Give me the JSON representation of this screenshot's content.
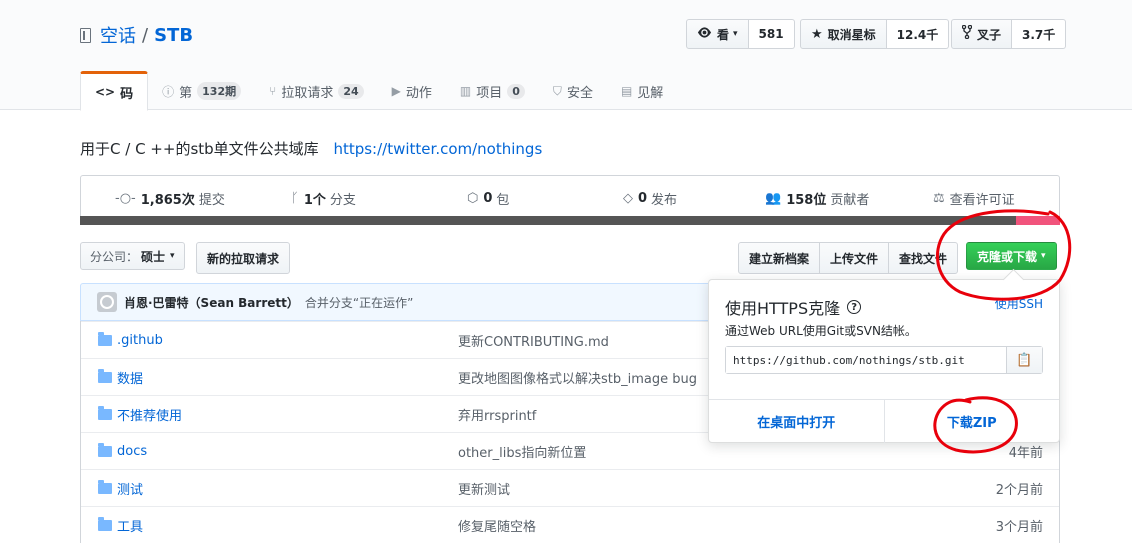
{
  "repo": {
    "owner": "空话",
    "separator": "/",
    "name": "STB"
  },
  "actions": {
    "watch_label": "看",
    "watch_count": "581",
    "star_label": "取消星标",
    "star_count": "12.4千",
    "fork_label": "叉子",
    "fork_count": "3.7千"
  },
  "tabs": [
    {
      "label": "码",
      "icon": "code-icon"
    },
    {
      "label": "第",
      "counter": "132期",
      "icon": "issue-icon"
    },
    {
      "label": "拉取请求",
      "counter": "24",
      "icon": "pull-request-icon"
    },
    {
      "label": "动作",
      "icon": "play-icon"
    },
    {
      "label": "项目",
      "counter": "0",
      "icon": "project-icon"
    },
    {
      "label": "安全",
      "icon": "shield-icon"
    },
    {
      "label": "见解",
      "icon": "graph-icon"
    }
  ],
  "description": {
    "text": "用于C / C ++的stb单文件公共域库",
    "link": "https://twitter.com/nothings"
  },
  "summary": {
    "commits_num": "1,865次",
    "commits_label": "提交",
    "branches_num": "1个",
    "branches_label": "分支",
    "packages_num": "0",
    "packages_label": "包",
    "releases_num": "0",
    "releases_label": "发布",
    "contributors_num": "158位",
    "contributors_label": "贡献者",
    "license_label": "查看许可证"
  },
  "language_colors": [
    "#555555",
    "#f1547c"
  ],
  "file_nav": {
    "branch_prefix": "分公司：",
    "branch_name": "硕士",
    "new_pr": "新的拉取请求",
    "create_file": "建立新档案",
    "upload_files": "上传文件",
    "find_file": "查找文件",
    "clone_download": "克隆或下载"
  },
  "commit": {
    "author": "肖恩·巴雷特（Sean Barrett）",
    "message": "合并分支“正在运作”"
  },
  "files": [
    {
      "name": ".github",
      "message": "更新CONTRIBUTING.md",
      "age": ""
    },
    {
      "name": "数据",
      "message": "更改地图图像格式以解决stb_image bug",
      "age": ""
    },
    {
      "name": "不推荐使用",
      "message": "弃用rrsprintf",
      "age": ""
    },
    {
      "name": "docs",
      "message": "other_libs指向新位置",
      "age": "4年前"
    },
    {
      "name": "测试",
      "message": "更新测试",
      "age": "2个月前"
    },
    {
      "name": "工具",
      "message": "修复尾随空格",
      "age": "3个月前"
    }
  ],
  "clone_popup": {
    "title": "使用HTTPS克隆",
    "help": "?",
    "ssh_link": "使用SSH",
    "hint": "通过Web URL使用Git或SVN结帐。",
    "url": "https://github.com/nothings/stb.git",
    "open_desktop": "在桌面中打开",
    "download_zip": "下载ZIP"
  },
  "annotation_color": "#e8000b"
}
